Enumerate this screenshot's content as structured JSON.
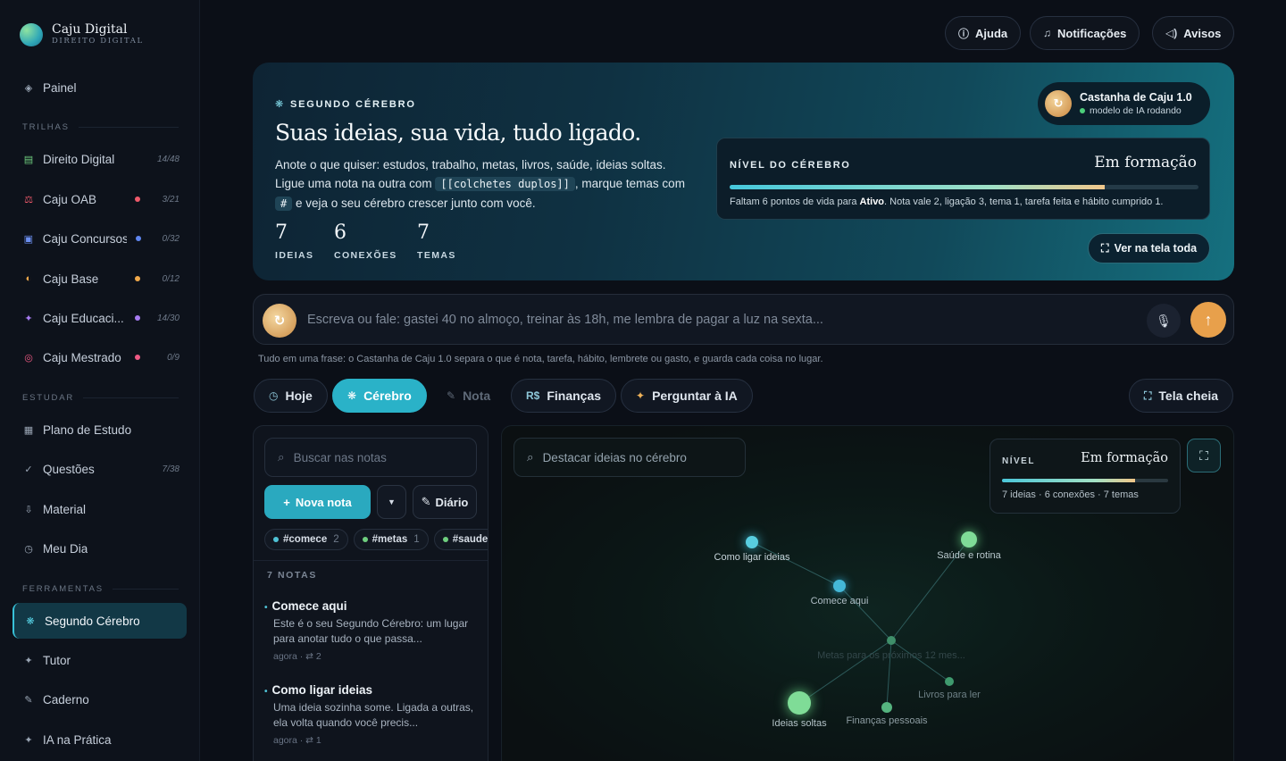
{
  "brand": {
    "title": "Caju Digital",
    "subtitle": "DIREITO DIGITAL"
  },
  "sidebar": {
    "panel": {
      "label": "Painel",
      "icon": "diamond-icon"
    },
    "trilhas_label": "TRILHAS",
    "trilhas": [
      {
        "label": "Direito Digital",
        "count": "14/48",
        "icon": "book-icon",
        "icon_color": "#6fcf7f",
        "dot": ""
      },
      {
        "label": "Caju OAB",
        "count": "3/21",
        "icon": "scale-icon",
        "icon_color": "#ef5a6b",
        "dot": "#ef5a6b"
      },
      {
        "label": "Caju Concursos",
        "count": "0/32",
        "icon": "building-icon",
        "icon_color": "#6c8ff0",
        "dot": "#5f86f0"
      },
      {
        "label": "Caju Base",
        "count": "0/12",
        "icon": "half-circle-icon",
        "icon_color": "#f0a94b",
        "dot": "#f0a94b"
      },
      {
        "label": "Caju Educaci...",
        "count": "14/30",
        "icon": "sparkle-icon",
        "icon_color": "#a77cf2",
        "dot": "#a77cf2"
      },
      {
        "label": "Caju Mestrado",
        "count": "0/9",
        "icon": "target-icon",
        "icon_color": "#ef5a84",
        "dot": "#ef5a84"
      }
    ],
    "estudar_label": "ESTUDAR",
    "estudar": [
      {
        "label": "Plano de Estudo",
        "count": "",
        "icon": "calendar-icon"
      },
      {
        "label": "Questões",
        "count": "7/38",
        "icon": "check-icon"
      },
      {
        "label": "Material",
        "count": "",
        "icon": "download-icon"
      },
      {
        "label": "Meu Dia",
        "count": "",
        "icon": "clock-icon"
      }
    ],
    "ferramentas_label": "FERRAMENTAS",
    "ferramentas": [
      {
        "label": "Segundo Cérebro",
        "icon": "asterisk-icon",
        "active": true
      },
      {
        "label": "Tutor",
        "icon": "sparkle-icon",
        "active": false
      },
      {
        "label": "Caderno",
        "icon": "pencil-icon",
        "active": false
      },
      {
        "label": "IA na Prática",
        "icon": "sparkle-icon",
        "active": false
      }
    ]
  },
  "topbar": {
    "help": "Ajuda",
    "notifications": "Notificações",
    "notices": "Avisos"
  },
  "hero": {
    "eyebrow": "SEGUNDO CÉREBRO",
    "title": "Suas ideias, sua vida, tudo ligado.",
    "desc_1": "Anote o que quiser: estudos, trabalho, metas, livros, saúde, ideias soltas. Ligue uma nota na outra com",
    "desc_code_1": "[[colchetes duplos]]",
    "desc_2": ", marque temas com",
    "desc_code_2": "#",
    "desc_3": "e veja o seu cérebro crescer junto com você.",
    "stats": [
      {
        "value": "7",
        "label": "IDEIAS"
      },
      {
        "value": "6",
        "label": "CONEXÕES"
      },
      {
        "value": "7",
        "label": "TEMAS"
      }
    ],
    "model": {
      "name": "Castanha de Caju 1.0",
      "status": "modelo de IA rodando"
    },
    "level": {
      "label": "NÍVEL DO CÉREBRO",
      "value": "Em formação",
      "progress": 0.8,
      "note_1": "Faltam 6 pontos de vida para ",
      "note_bold": "Ativo",
      "note_2": ". Nota vale 2, ligação 3, tema 1, tarefa feita e hábito cumprido 1."
    },
    "fullscreen": "Ver na tela toda"
  },
  "compose": {
    "placeholder": "Escreva ou fale: gastei 40 no almoço, treinar às 18h, me lembra de pagar a luz na sexta...",
    "hint": "Tudo em uma frase: o Castanha de Caju 1.0 separa o que é nota, tarefa, hábito, lembrete ou gasto, e guarda cada coisa no lugar."
  },
  "tabs": [
    {
      "label": "Hoje",
      "icon": "clock-icon",
      "state": "normal"
    },
    {
      "label": "Cérebro",
      "icon": "asterisk-icon",
      "state": "active"
    },
    {
      "label": "Nota",
      "icon": "pencil-icon",
      "state": "muted"
    },
    {
      "label": "Finanças",
      "icon": "currency-icon",
      "state": "normal"
    },
    {
      "label": "Perguntar à IA",
      "icon": "sparkle-icon",
      "state": "normal"
    }
  ],
  "tab_fullscreen": "Tela cheia",
  "notes": {
    "search_placeholder": "Buscar nas notas",
    "new_note": "Nova nota",
    "diary": "Diário",
    "tags": [
      {
        "label": "#comece",
        "count": "2",
        "color": "#4fc3d6"
      },
      {
        "label": "#metas",
        "count": "1",
        "color": "#6fcf7f"
      },
      {
        "label": "#saude",
        "count": "",
        "color": "#6fcf7f"
      }
    ],
    "count_label": "7 NOTAS",
    "items": [
      {
        "title": "Comece aqui",
        "preview": "Este é o seu Segundo Cérebro: um lugar para anotar tudo o que passa...",
        "meta": "agora · ⇄ 2"
      },
      {
        "title": "Como ligar ideias",
        "preview": "Uma ideia sozinha some. Ligada a outras, ela volta quando você precis...",
        "meta": "agora · ⇄ 1"
      }
    ]
  },
  "graph": {
    "search_placeholder": "Destacar ideias no cérebro",
    "level_label": "NÍVEL",
    "level_value": "Em formação",
    "level_progress": 0.8,
    "level_sub": "7 ideias · 6 conexões · 7 temas",
    "nodes": [
      {
        "label": "Como ligar ideias",
        "color": "#58cde0"
      },
      {
        "label": "Comece aqui",
        "color": "#44b8d8"
      },
      {
        "label": "Saúde e rotina",
        "color": "#7fdc97"
      },
      {
        "label": "Metas para os próximos 12 mes...",
        "color": "#3f8f6a"
      },
      {
        "label": "Livros para ler",
        "color": "#3f9a6e"
      },
      {
        "label": "Ideias soltas",
        "color": "#7fdc97"
      },
      {
        "label": "Finanças pessoais",
        "color": "#55b47f"
      }
    ]
  }
}
